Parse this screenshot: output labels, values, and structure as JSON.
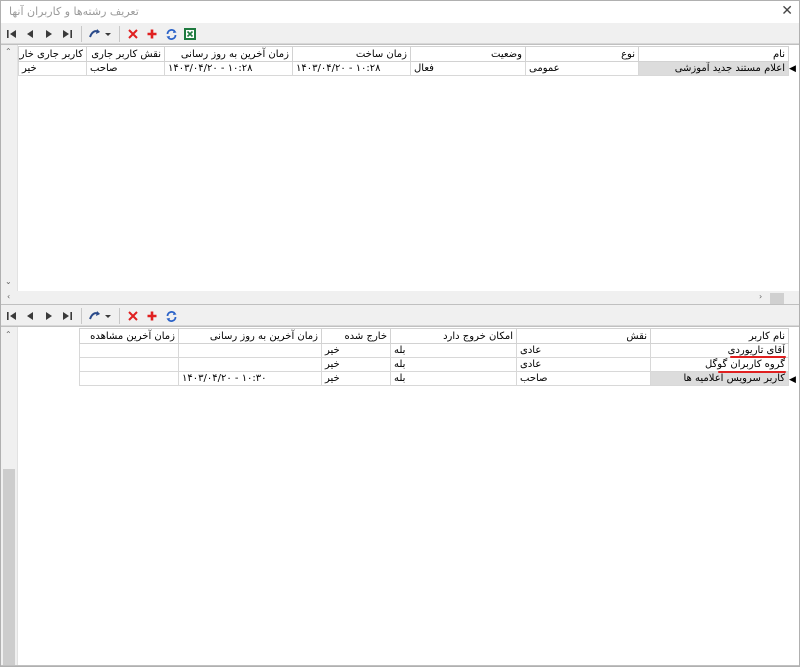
{
  "window": {
    "title": "تعریف رشته‌ها و کاربران آنها",
    "close": "✕"
  },
  "colors": {
    "accent_red": "#e02020",
    "refresh_blue": "#2a62c8",
    "excel_green": "#1d7a3e",
    "nav_dark": "#3a3a3a"
  },
  "toolbar_top": {
    "icons": [
      "first-icon",
      "prev-icon",
      "next-icon",
      "last-icon",
      "action-dropdown-icon",
      "delete-icon",
      "add-icon",
      "refresh-icon",
      "excel-icon"
    ]
  },
  "toolbar_bottom": {
    "icons": [
      "first-icon",
      "prev-icon",
      "next-icon",
      "last-icon",
      "action-dropdown-icon",
      "delete-icon",
      "add-icon",
      "refresh-icon"
    ]
  },
  "topGrid": {
    "headers": [
      "نام",
      "نوع",
      "وضعیت",
      "زمان ساخت",
      "زمان آخرین به روز رسانی",
      "نقش کاربر جاری",
      "کاربر جاری خارج ش"
    ],
    "rows": [
      [
        "اعلام مستند جدید آموزشی",
        "عمومی",
        "فعال",
        "۱۰:۲۸ - ۱۴۰۳/۰۴/۲۰",
        "۱۰:۲۸ - ۱۴۰۳/۰۴/۲۰",
        "صاحب",
        "خیر"
      ]
    ]
  },
  "bottomGrid": {
    "headers": [
      "نام کاربر",
      "نقش",
      "امکان خروج دارد",
      "خارج شده",
      "زمان آخرین به روز رسانی",
      "زمان آخرین مشاهده"
    ],
    "rows": [
      [
        "آقای تاریوردی",
        "عادی",
        "بله",
        "خیر",
        "",
        ""
      ],
      [
        "گروه کاربران گوگل",
        "عادی",
        "بله",
        "خیر",
        "",
        ""
      ],
      [
        "کاربر سرویس اعلامیه ها",
        "صاحب",
        "بله",
        "خیر",
        "۱۰:۳۰ - ۱۴۰۳/۰۴/۲۰",
        ""
      ]
    ]
  }
}
